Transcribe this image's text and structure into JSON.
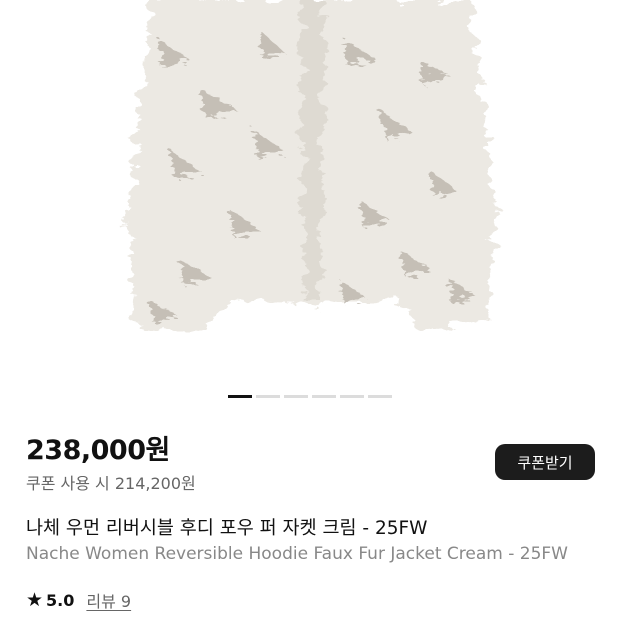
{
  "product": {
    "price": "238,000원",
    "coupon_price": "쿠폰 사용 시 214,200원",
    "coupon_button": "쿠폰받기",
    "title_ko": "나체 우먼 리버시블 후디 포우 퍼 자켓 크림 - 25FW",
    "title_en": "Nache Women Reversible Hoodie Faux Fur Jacket Cream - 25FW",
    "rating": "5.0",
    "review_label": "리뷰 9",
    "star_icon": "star-icon"
  },
  "gallery": {
    "slide_count": 6,
    "active_slide": 1
  },
  "colors": {
    "coupon_button_bg": "#1c1c1c",
    "pager_active": "#111111",
    "pager_inactive": "#dcdcdc"
  }
}
